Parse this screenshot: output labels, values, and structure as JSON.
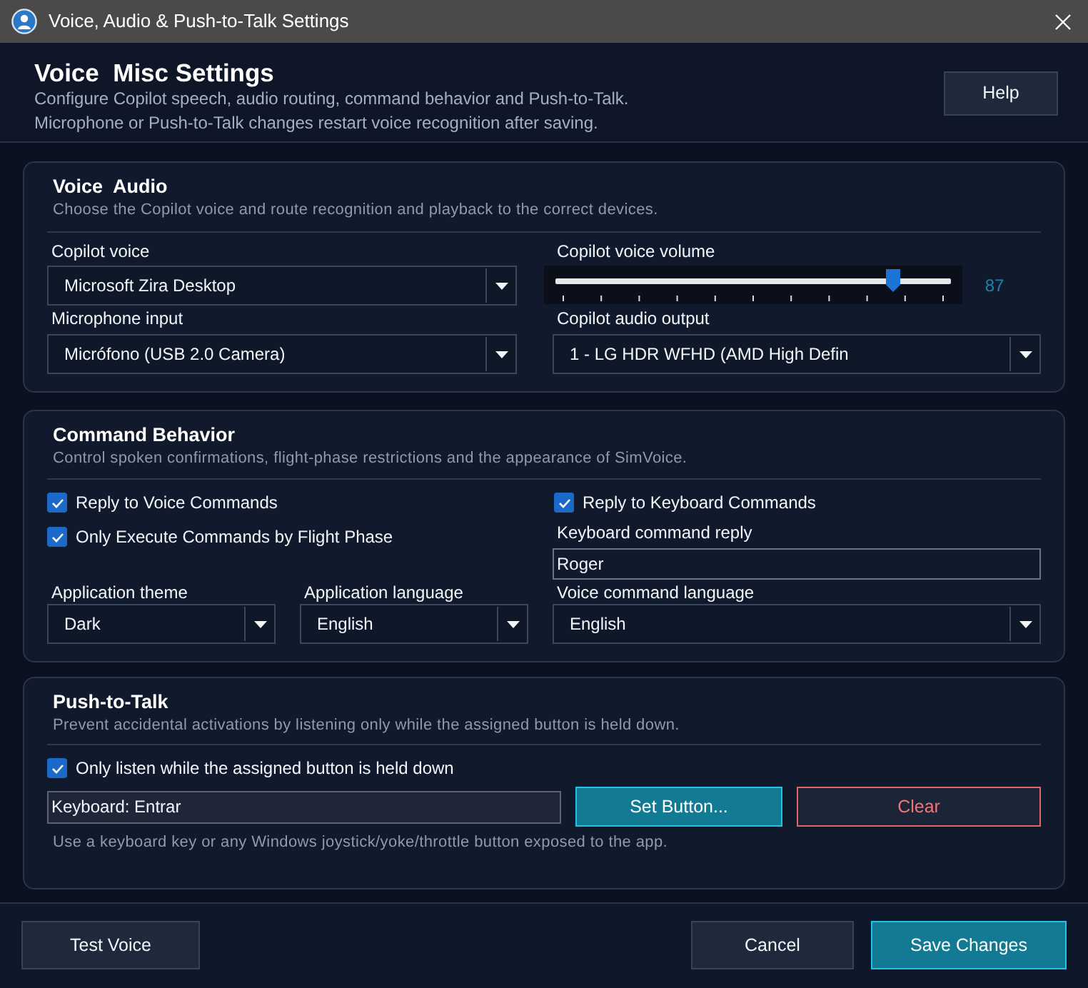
{
  "window": {
    "title": "Voice, Audio & Push-to-Talk Settings"
  },
  "header": {
    "title": "Voice  Misc Settings",
    "lines": [
      "Configure Copilot speech, audio routing, command behavior and Push-to-Talk.",
      "Microphone or Push-to-Talk changes restart voice recognition after saving."
    ],
    "help_button": "Help"
  },
  "voice_audio": {
    "title": "Voice  Audio",
    "description": "Choose the Copilot voice and route recognition and playback to the correct devices.",
    "copilot_voice": {
      "label": "Copilot voice",
      "value": "Microsoft Zira Desktop"
    },
    "volume": {
      "label": "Copilot voice volume",
      "level": 0.87,
      "reading": "87"
    },
    "microphone": {
      "label": "Microphone input",
      "value": "Micrófono (USB 2.0 Camera)"
    },
    "audio_output": {
      "label": "Copilot audio output",
      "value": "1 - LG HDR WFHD (AMD High Defin"
    }
  },
  "command_behavior": {
    "title": "Command Behavior",
    "description": "Control spoken confirmations, flight-phase restrictions and the appearance of SimVoice.",
    "left_options": [
      {
        "label": "Reply to Voice Commands",
        "checked": true
      },
      {
        "label": "Only Execute Commands by Flight Phase",
        "checked": true
      }
    ],
    "keyboard_option": {
      "label": "Reply to Keyboard Commands",
      "checked": true
    },
    "keyboard_reply": {
      "label": "Keyboard command reply",
      "value": "Roger"
    },
    "dropdowns": [
      {
        "label": "Application theme",
        "value": "Dark"
      },
      {
        "label": "Application language",
        "value": "English"
      },
      {
        "label": "Voice command language",
        "value": "English"
      }
    ]
  },
  "push_to_talk": {
    "title": "Push-to-Talk",
    "description": "Prevent accidental activations by listening only while the assigned button is held down.",
    "option": {
      "label": "Only listen while the assigned button is held down",
      "checked": true
    },
    "binding": {
      "value": "Keyboard: Entrar"
    },
    "set_button": "Set Button...",
    "clear_button": "Clear",
    "hint": "Use a keyboard key or any Windows joystick/yoke/throttle button exposed to the app."
  },
  "footer": {
    "test_button": "Test Voice",
    "cancel_button": "Cancel",
    "save_button": "Save Changes"
  }
}
